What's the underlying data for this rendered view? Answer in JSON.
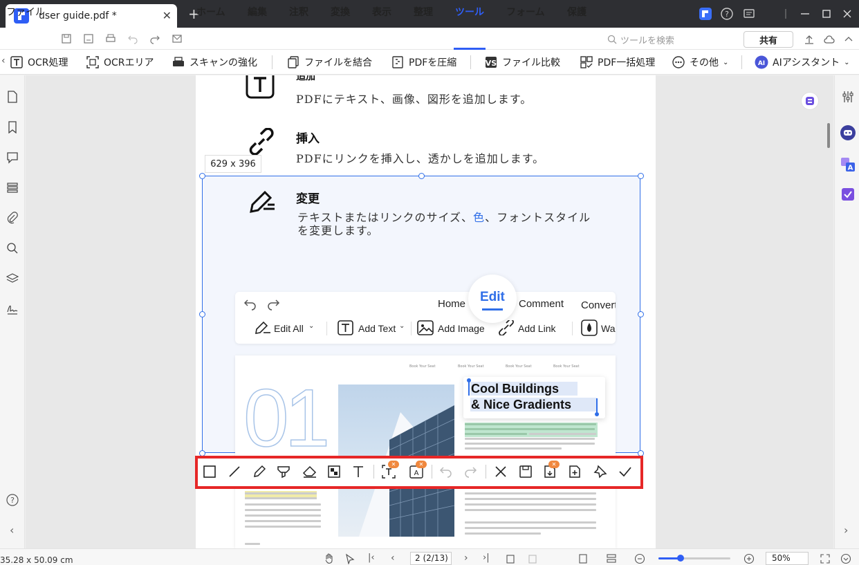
{
  "window": {
    "tab_title": "user guide.pdf *"
  },
  "menu": {
    "file": "ファイル",
    "items": [
      "ホーム",
      "編集",
      "注釈",
      "変換",
      "表示",
      "整理",
      "ツール",
      "フォーム",
      "保護"
    ],
    "active": "ツール",
    "search_placeholder": "ツールを検索",
    "share": "共有"
  },
  "tools": {
    "ocr": "OCR処理",
    "ocr_area": "OCRエリア",
    "scan": "スキャンの強化",
    "combine": "ファイルを結合",
    "compress": "PDFを圧縮",
    "compare": "ファイル比較",
    "batch": "PDF一括処理",
    "more": "その他",
    "ai": "AIアシスタント"
  },
  "doc": {
    "add_heading": "追加",
    "add_desc": "PDFにテキスト、画像、図形を追加します。",
    "insert_heading": "挿入",
    "insert_desc": "PDFにリンクを挿入し、透かしを追加します。",
    "change_heading": "変更",
    "change_desc_a": "テキストまたはリンクのサイズ、",
    "change_desc_color": "色",
    "change_desc_b": "、フォントスタイル",
    "change_desc_c": "を変更します。",
    "edit_tabs": {
      "home": "Home",
      "edit": "Edit",
      "comment": "Comment",
      "convert": "Convert"
    },
    "edit_tools": {
      "edit_all": "Edit All",
      "add_text": "Add Text",
      "add_image": "Add Image",
      "add_link": "Add Link",
      "wa": "Wa"
    },
    "mag_big": "01",
    "mag_small": "Book Your Seat",
    "mag_title_1": "Cool Buildings",
    "mag_title_2": "& Nice Gradients"
  },
  "selection": {
    "size": "629 x 396"
  },
  "status": {
    "dims": "35.28 x 50.09 cm",
    "page": "2 (2/13)",
    "zoom": "50%"
  },
  "colors": {
    "accent": "#2f5ef5",
    "selection": "#2f6ee8",
    "highlight": "#e62727",
    "badge": "#f0883e"
  }
}
